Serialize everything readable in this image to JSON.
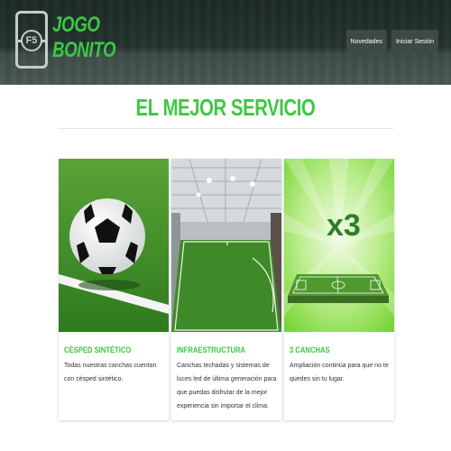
{
  "header": {
    "logo_badge": "F5",
    "logo_line1": "JOGO",
    "logo_line2": "BONITO",
    "nav": [
      "Novedades",
      "Iniciar Sesión"
    ]
  },
  "main": {
    "title": "EL MEJOR SERVICIO",
    "cards": [
      {
        "title": "CÉSPED SINTÉTICO",
        "description": "Todas nuestras canchas cuentan con césped sintético."
      },
      {
        "title": "INFRAESTRUCTURA",
        "description": "Canchas techadas y sistemas de luces led de última generación para que puedas disfrutar de la mejor experiencia sin importar el clima."
      },
      {
        "title": "3 CANCHAS",
        "badge": "x3",
        "description": "Ampliación continúa para que no te quedes sin tu lugar."
      }
    ]
  },
  "colors": {
    "accent": "#3ec743",
    "header_bg": "#243330",
    "nav_btn": "#3d4946"
  }
}
